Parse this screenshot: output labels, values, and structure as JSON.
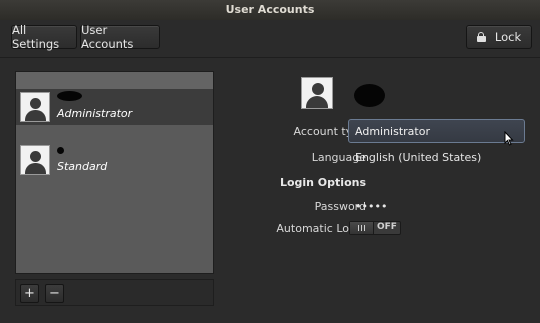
{
  "window": {
    "title": "User Accounts"
  },
  "toolbar": {
    "all_settings": "All Settings",
    "user_accounts": "User Accounts",
    "lock": "Lock"
  },
  "users": [
    {
      "type": "Administrator",
      "selected": true
    },
    {
      "type": "Standard",
      "selected": false
    }
  ],
  "list_controls": {
    "add": "+",
    "remove": "−"
  },
  "details": {
    "account_type_label": "Account type",
    "account_type_value": "Administrator",
    "language_label": "Language",
    "language_value": "English (United States)",
    "login_options_heading": "Login Options",
    "password_label": "Password",
    "password_value": "•••••",
    "auto_login_label": "Automatic Login",
    "auto_login_state": "OFF"
  },
  "colors": {
    "window_bg": "#2b2b2b",
    "list_bg": "#5a5a5a",
    "selected_row": "#3c3c3c",
    "combo_border": "#6b7b92"
  }
}
